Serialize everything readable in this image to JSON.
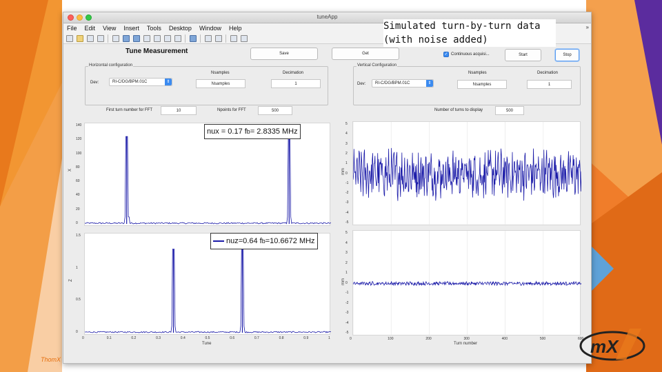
{
  "slide": {
    "callout_line1": "Simulated turn-by-turn data",
    "callout_line2": "(with noise added)",
    "footer": "ThomX",
    "logo_text": "ThomX",
    "colors": {
      "accent_orange": "#e8791c",
      "accent_purple": "#5b2c9e",
      "accent_blue": "#5fa2d8",
      "plot_line": "#1a1aa8"
    }
  },
  "window": {
    "title": "tuneApp"
  },
  "menu": [
    "File",
    "Edit",
    "View",
    "Insert",
    "Tools",
    "Desktop",
    "Window",
    "Help"
  ],
  "menu_overflow": "»",
  "toolbar_icons": [
    "new-file-icon",
    "open-folder-icon",
    "save-icon",
    "print-icon",
    "pointer-icon",
    "zoom-in-icon",
    "zoom-out-icon",
    "pan-icon",
    "rotate-icon",
    "data-cursor-icon",
    "brush-icon",
    "link-icon",
    "colorbar-icon",
    "legend-icon",
    "hide-plot-icon",
    "show-plot-icon"
  ],
  "panel": {
    "title": "Tune Measurement",
    "save_label": "Save",
    "get_label": "Get",
    "continuous_label": "Continuous acquisi...",
    "continuous_checked": true,
    "start_label": "Start",
    "stop_label": "Stop"
  },
  "horizontal": {
    "group_title": "Horizontal configuration",
    "dev_label": "Dev:",
    "dev_value": "RI-C/DG/BPM.01C",
    "nsamples_label": "Nsamples",
    "nsamples_value": "Nsamples",
    "decimation_label": "Decimation",
    "decimation_value": "1"
  },
  "vertical": {
    "group_title": "Vertical Configuration",
    "dev_label": "Dev:",
    "dev_value": "RI-C/DG/BPM.01C",
    "nsamples_label": "Nsamples",
    "nsamples_value": "Nsamples",
    "decimation_label": "Decimation",
    "decimation_value": "1"
  },
  "fft_row": {
    "first_label": "First turn number for FFT",
    "first_value": "10",
    "npoints_label": "Npoints for FFT",
    "npoints_value": "500",
    "display_label": "Number of turns to display",
    "display_value": "500"
  },
  "chart_data": [
    {
      "type": "line",
      "title": "",
      "xlabel": "",
      "ylabel": "X",
      "xlim": [
        0,
        1
      ],
      "ylim": [
        0,
        140
      ],
      "yticks": [
        "140",
        "120",
        "100",
        "80",
        "60",
        "40",
        "20",
        "0"
      ],
      "legend": "nux = 0.17   f",
      "legend_sub": "b",
      "legend_rest": " = 2.8335 MHz",
      "peaks": [
        {
          "x": 0.17,
          "y": 125
        },
        {
          "x": 0.83,
          "y": 125
        }
      ],
      "noise_level": 2
    },
    {
      "type": "line",
      "title": "",
      "xlabel": "Tune",
      "ylabel": "Z",
      "xlim": [
        0,
        1
      ],
      "ylim": [
        0,
        1.5
      ],
      "yticks": [
        "1.5",
        "1",
        "0.5",
        "0"
      ],
      "xticks": [
        "0",
        "0.1",
        "0.2",
        "0.3",
        "0.4",
        "0.5",
        "0.6",
        "0.7",
        "0.8",
        "0.9",
        "1"
      ],
      "legend": "nuz=0.64  f",
      "legend_sub": "b",
      "legend_rest": "=10.6672 MHz",
      "peaks": [
        {
          "x": 0.36,
          "y": 1.3
        },
        {
          "x": 0.64,
          "y": 1.3
        }
      ],
      "noise_level": 0.02
    },
    {
      "type": "line",
      "title": "",
      "xlabel": "",
      "ylabel": "mm",
      "xlim": [
        0,
        600
      ],
      "ylim": [
        -5,
        5
      ],
      "yticks": [
        "5",
        "4",
        "3",
        "2",
        "1",
        "0",
        "-1",
        "-2",
        "-3",
        "-4",
        "-5"
      ],
      "amplitude": 2
    },
    {
      "type": "line",
      "title": "",
      "xlabel": "Turn number",
      "ylabel": "mm",
      "xlim": [
        0,
        600
      ],
      "ylim": [
        -5,
        5
      ],
      "yticks": [
        "5",
        "4",
        "3",
        "2",
        "1",
        "0",
        "-1",
        "-2",
        "-3",
        "-4",
        "-5"
      ],
      "xticks": [
        "0",
        "100",
        "200",
        "300",
        "400",
        "500",
        "600"
      ],
      "amplitude": 0.15
    }
  ]
}
